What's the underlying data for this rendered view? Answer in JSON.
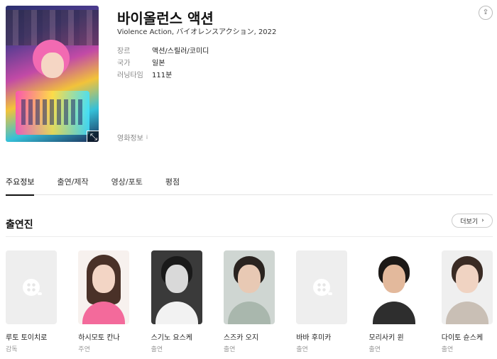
{
  "movie": {
    "title": "바이올런스 액션",
    "subtitle": "Violence Action, バイオレンスアクション, 2022",
    "info": [
      {
        "label": "장르",
        "value": "액션/스릴러/코미디"
      },
      {
        "label": "국가",
        "value": "일본"
      },
      {
        "label": "러닝타임",
        "value": "111분"
      }
    ],
    "movie_info_label": "영화정보",
    "movie_info_icon": "i"
  },
  "icons": {
    "share": "⇪",
    "expand": "⤡",
    "more_chevron": "›"
  },
  "tabs": [
    {
      "label": "주요정보",
      "active": true
    },
    {
      "label": "출연/제작",
      "active": false
    },
    {
      "label": "영상/포토",
      "active": false
    },
    {
      "label": "평점",
      "active": false
    }
  ],
  "cast_section": {
    "title": "출연진",
    "more_label": "더보기",
    "members": [
      {
        "name": "루토 토이치로",
        "role": "감독",
        "photo": "placeholder"
      },
      {
        "name": "하시모토 칸나",
        "role": "주연",
        "photo": "photo"
      },
      {
        "name": "스기노 요스케",
        "role": "출연",
        "photo": "photo"
      },
      {
        "name": "스즈카 오지",
        "role": "출연",
        "photo": "photo"
      },
      {
        "name": "바바 후미카",
        "role": "출연",
        "photo": "placeholder"
      },
      {
        "name": "모리사키 윈",
        "role": "출연",
        "photo": "photo"
      },
      {
        "name": "다이토 슌스케",
        "role": "출연",
        "photo": "photo"
      }
    ]
  }
}
